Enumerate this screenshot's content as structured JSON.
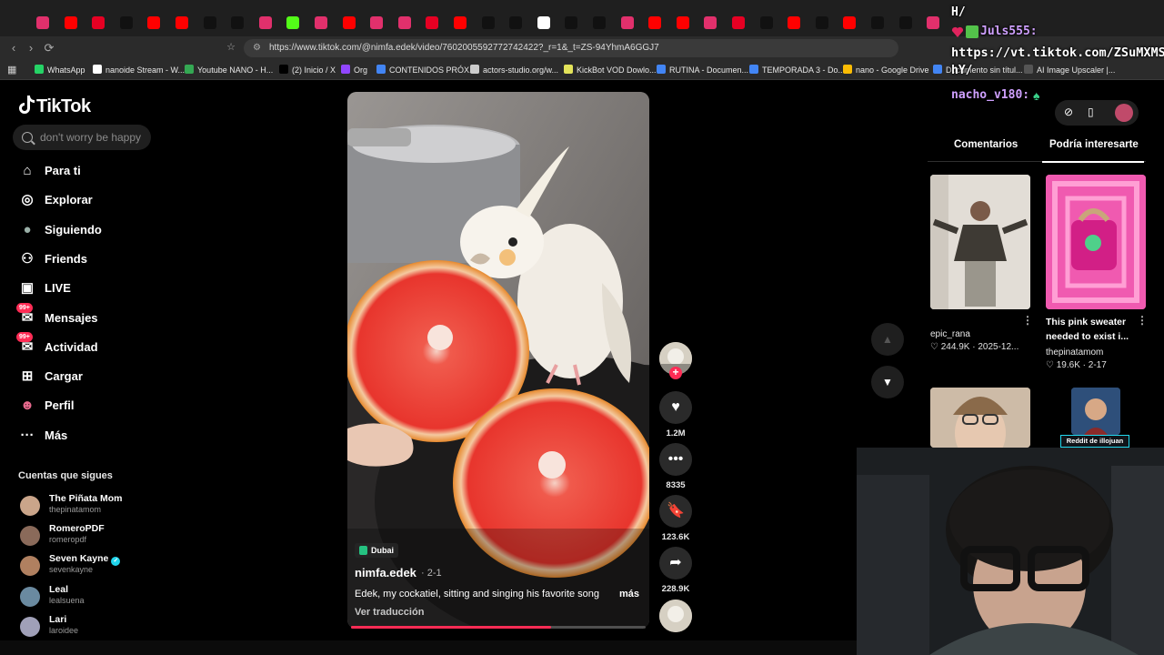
{
  "browser": {
    "url": "https://www.tiktok.com/@nimfa.edek/video/7602005592772742422?_r=1&_t=ZS-94YhmA6GGJ7",
    "bookmarks": [
      {
        "label": "WhatsApp",
        "color": "#25d366"
      },
      {
        "label": "nanoide Stream - W...",
        "color": "#ffffff"
      },
      {
        "label": "Youtube NANO - H...",
        "color": "#34a853"
      },
      {
        "label": "(2) Inicio / X",
        "color": "#000000"
      },
      {
        "label": "Org",
        "color": "#9146ff"
      },
      {
        "label": "CONTENIDOS PRÓX...",
        "color": "#4285f4"
      },
      {
        "label": "actors-studio.org/w...",
        "color": "#cccccc"
      },
      {
        "label": "KickBot VOD Dowlo...",
        "color": "#e3e35a"
      },
      {
        "label": "RUTINA - Documen...",
        "color": "#4285f4"
      },
      {
        "label": "TEMPORADA 3 - Do...",
        "color": "#4285f4"
      },
      {
        "label": "nano - Google Drive",
        "color": "#fbbc04"
      },
      {
        "label": "Documento sin títul...",
        "color": "#4285f4"
      },
      {
        "label": "AI Image Upscaler |...",
        "color": "#555555"
      }
    ]
  },
  "sidebar": {
    "logo": "TikTok",
    "search_placeholder": "don't worry be happy",
    "nav": [
      {
        "label": "Para ti",
        "icon": "home-icon"
      },
      {
        "label": "Explorar",
        "icon": "compass-icon"
      },
      {
        "label": "Siguiendo",
        "icon": "following-avatar-icon"
      },
      {
        "label": "Friends",
        "icon": "friends-icon"
      },
      {
        "label": "LIVE",
        "icon": "live-icon"
      },
      {
        "label": "Mensajes",
        "icon": "messages-icon",
        "badge": "99+"
      },
      {
        "label": "Actividad",
        "icon": "activity-icon",
        "badge": "99+"
      },
      {
        "label": "Cargar",
        "icon": "upload-icon"
      },
      {
        "label": "Perfil",
        "icon": "profile-avatar-icon"
      },
      {
        "label": "Más",
        "icon": "more-icon"
      }
    ],
    "following_title": "Cuentas que sigues",
    "following": [
      {
        "name": "The Piñata Mom",
        "handle": "thepinatamom",
        "verified": false,
        "color": "#caa58a"
      },
      {
        "name": "RomeroPDF",
        "handle": "romeropdf",
        "verified": false,
        "color": "#8a6a5a"
      },
      {
        "name": "Seven Kayne",
        "handle": "sevenkayne",
        "verified": true,
        "color": "#b08060"
      },
      {
        "name": "Leal",
        "handle": "lealsuena",
        "verified": false,
        "color": "#6a8aa0"
      },
      {
        "name": "Lari",
        "handle": "laroidee",
        "verified": false,
        "color": "#a0a0b8"
      }
    ]
  },
  "video": {
    "location": "Dubai",
    "author": "nimfa.edek",
    "date": "· 2-1",
    "caption": "Edek, my cockatiel, sitting and singing his favorite song",
    "more": "más",
    "translate": "Ver traducción",
    "progress": 0.68,
    "likes": "1.2M",
    "comments": "8335",
    "saves": "123.6K",
    "shares": "228.9K"
  },
  "right_panel": {
    "tabs": [
      "Comentarios",
      "Podría interesarte"
    ],
    "active_tab": "Podría interesarte",
    "cards": [
      {
        "author": "epic_rana",
        "title": "",
        "stats": "244.9K · 2025-12..."
      },
      {
        "author": "thepinatamom",
        "title": "This pink sweater needed to exist i...",
        "stats": "19.6K · 2-17"
      }
    ]
  },
  "overlay": {
    "chat_lines": [
      "H/",
      "Juls555:",
      "https://vt.tiktok.com/ZSuMXMS",
      "hY/",
      "nacho_v180:"
    ],
    "reddit_label": "Reddit de illojuan"
  }
}
